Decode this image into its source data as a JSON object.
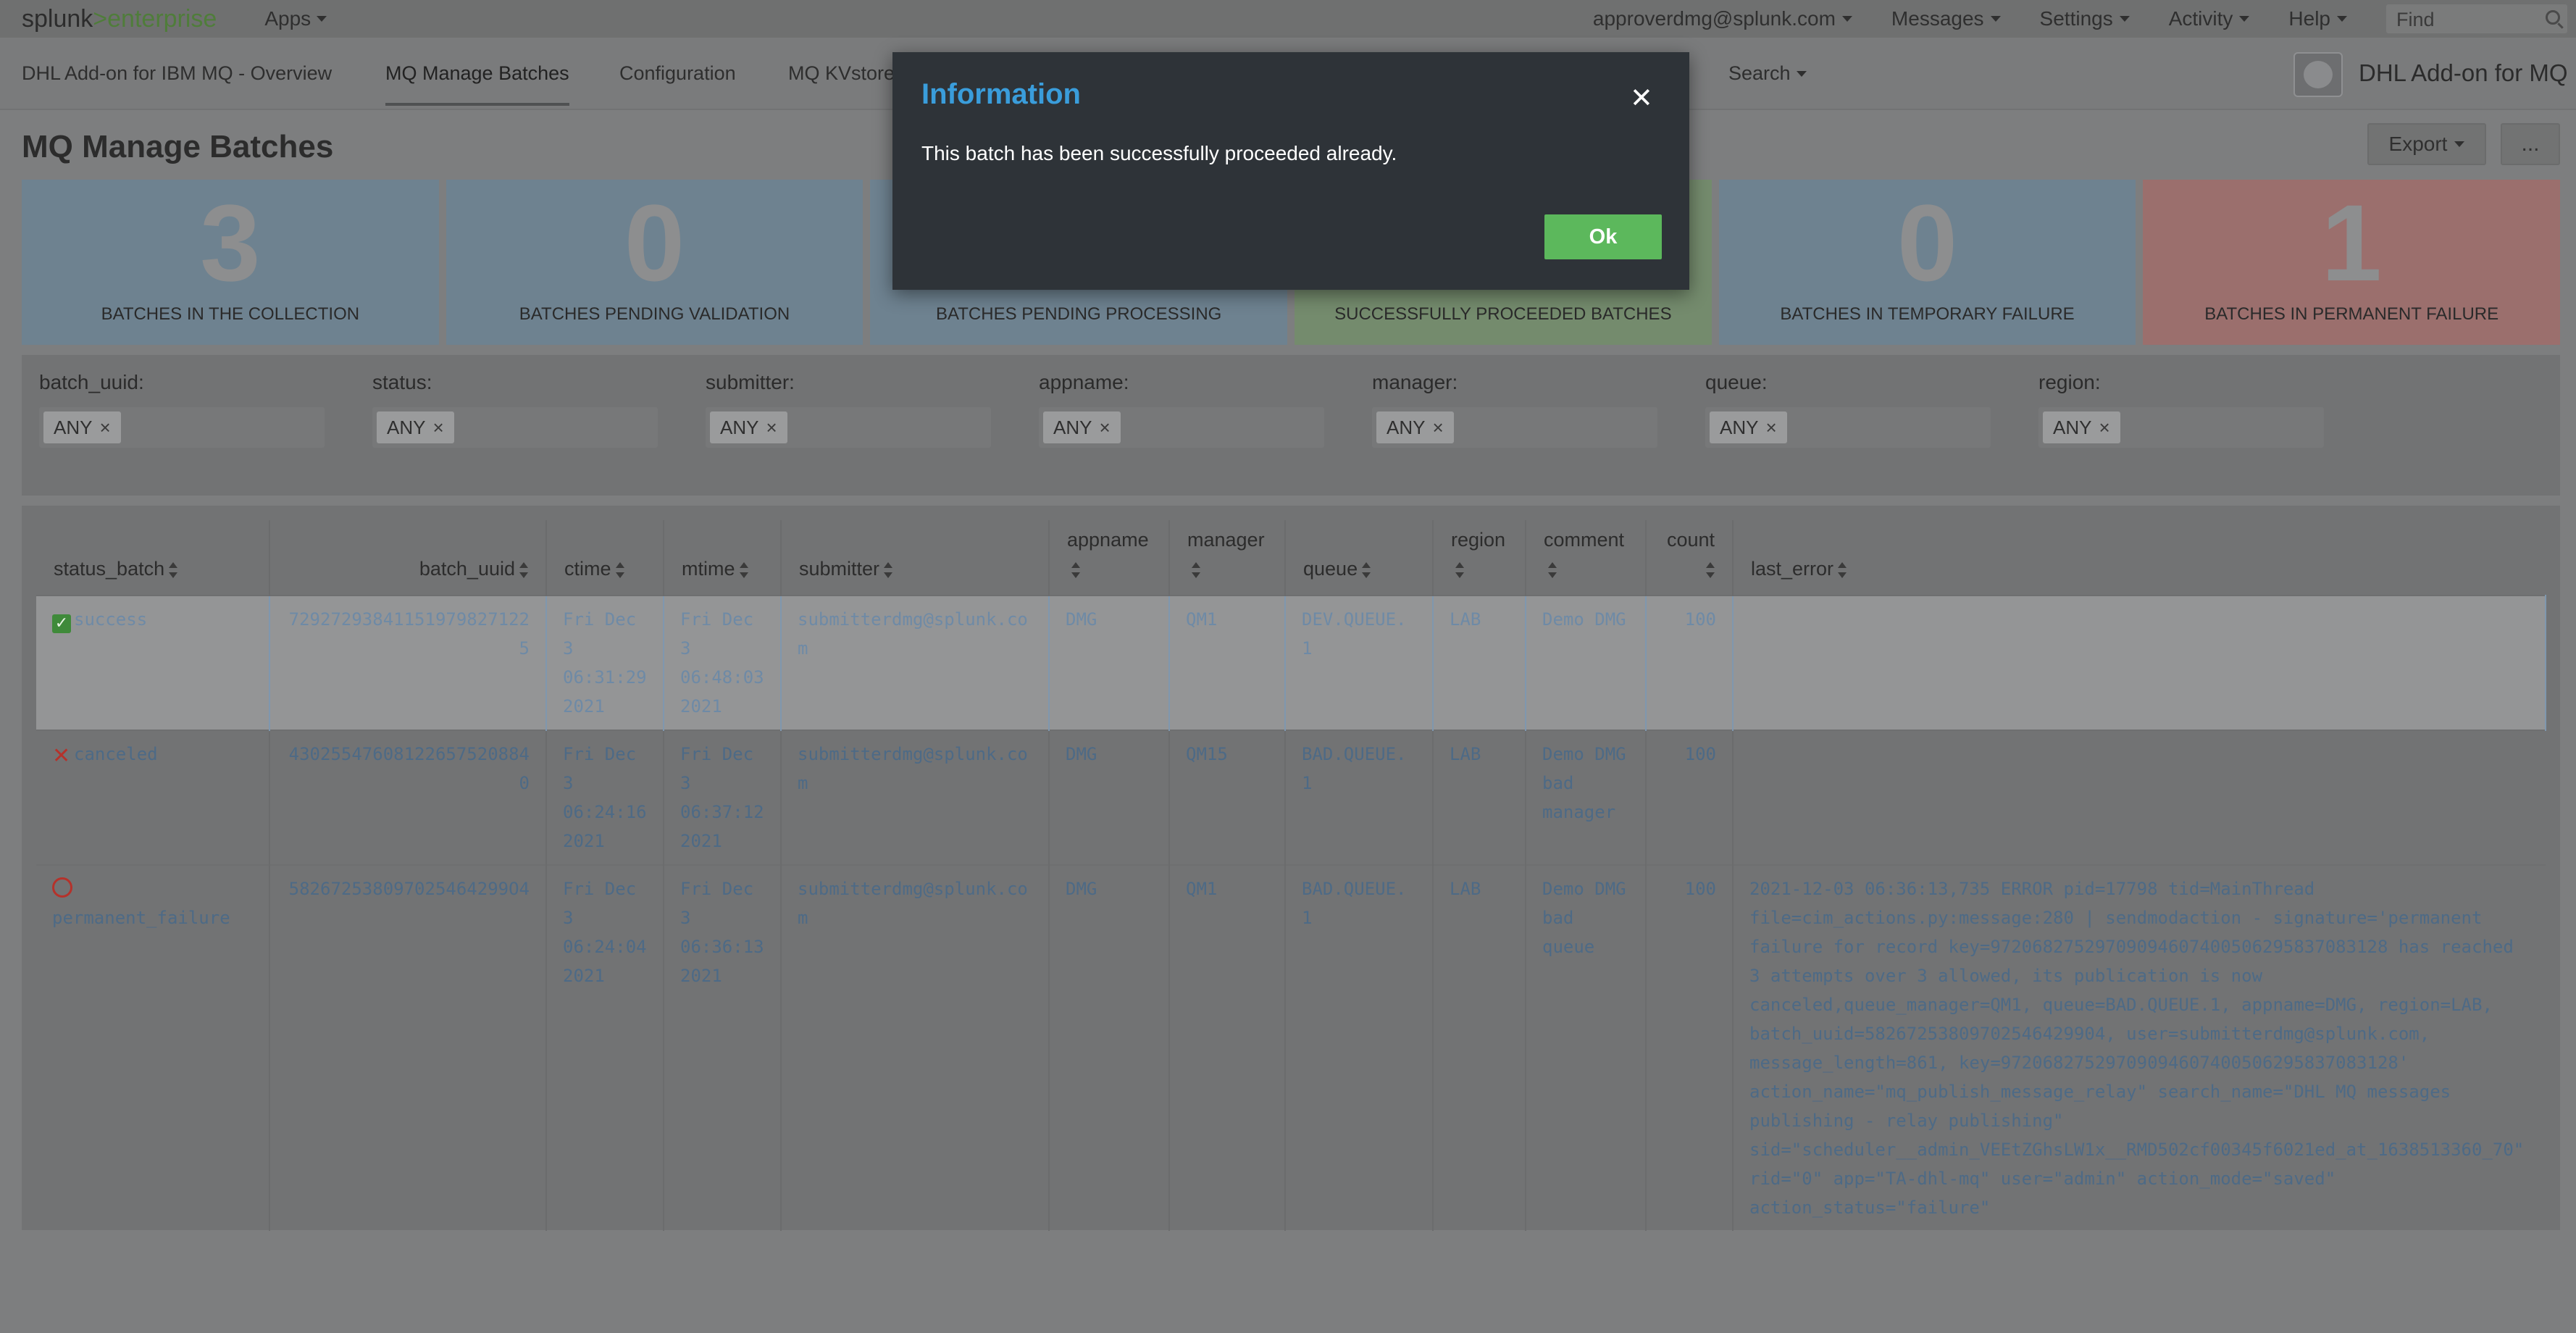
{
  "global_bar": {
    "logo_splunk": "splunk",
    "logo_sep": ">",
    "logo_product": "enterprise",
    "apps": "Apps",
    "user": "approverdmg@splunk.com",
    "messages": "Messages",
    "settings": "Settings",
    "activity": "Activity",
    "help": "Help",
    "find_placeholder": "Find"
  },
  "app_nav": {
    "tabs": [
      {
        "label": "DHL Add-on for IBM MQ - Overview"
      },
      {
        "label": "MQ Manage Batches",
        "active": true
      },
      {
        "label": "Configuration"
      },
      {
        "label": "MQ KVstore"
      }
    ],
    "search": "Search",
    "app_title": "DHL Add-on for MQ"
  },
  "page": {
    "title": "MQ Manage Batches",
    "export_label": "Export",
    "more_label": "..."
  },
  "kpis": [
    {
      "value": "3",
      "label": "BATCHES IN THE COLLECTION",
      "color": "#6e8290"
    },
    {
      "value": "0",
      "label": "BATCHES PENDING VALIDATION",
      "color": "#6e8290"
    },
    {
      "value": "",
      "label": "BATCHES PENDING PROCESSING",
      "color": "#6e8290"
    },
    {
      "value": "",
      "label": "SUCCESSFULLY PROCEEDED BATCHES",
      "color": "#748b6d"
    },
    {
      "value": "0",
      "label": "BATCHES IN TEMPORARY FAILURE",
      "color": "#6e8290"
    },
    {
      "value": "1",
      "label": "BATCHES IN PERMANENT FAILURE",
      "color": "#9b6f6d"
    }
  ],
  "filters": [
    {
      "label": "batch_uuid:",
      "value": "ANY"
    },
    {
      "label": "status:",
      "value": "ANY"
    },
    {
      "label": "submitter:",
      "value": "ANY"
    },
    {
      "label": "appname:",
      "value": "ANY"
    },
    {
      "label": "manager:",
      "value": "ANY"
    },
    {
      "label": "queue:",
      "value": "ANY"
    },
    {
      "label": "region:",
      "value": "ANY"
    }
  ],
  "table": {
    "columns": [
      "status_batch",
      "batch_uuid",
      "ctime",
      "mtime",
      "submitter",
      "appname",
      "manager",
      "queue",
      "region",
      "comment",
      "count",
      "last_error"
    ],
    "rows": [
      {
        "status_icon": "check-icon",
        "status_batch": "success",
        "batch_uuid": "729272938411519798271225",
        "ctime": [
          "Fri Dec",
          "3",
          "06:31:29",
          "2021"
        ],
        "mtime": [
          "Fri Dec",
          "3",
          "06:48:03",
          "2021"
        ],
        "submitter": "submitterdmg@splunk.com",
        "appname": "DMG",
        "manager": "QM1",
        "queue": "DEV.QUEUE.1",
        "region": "LAB",
        "comment": [
          "Demo DMG"
        ],
        "count": "100",
        "last_error": ""
      },
      {
        "status_icon": "cross-icon",
        "status_batch": "canceled",
        "batch_uuid": "430255476081226575208840",
        "ctime": [
          "Fri Dec",
          "3",
          "06:24:16",
          "2021"
        ],
        "mtime": [
          "Fri Dec",
          "3",
          "06:37:12",
          "2021"
        ],
        "submitter": "submitterdmg@splunk.com",
        "appname": "DMG",
        "manager": "QM15",
        "queue": "BAD.QUEUE.1",
        "region": "LAB",
        "comment": [
          "Demo DMG",
          "bad",
          "manager"
        ],
        "count": "100",
        "last_error": ""
      },
      {
        "status_icon": "blocked-icon",
        "status_batch": "permanent_failure",
        "batch_uuid": "582672538097025464299O4",
        "ctime": [
          "Fri Dec",
          "3",
          "06:24:04",
          "2021"
        ],
        "mtime": [
          "Fri Dec",
          "3",
          "06:36:13",
          "2021"
        ],
        "submitter": "submitterdmg@splunk.com",
        "appname": "DMG",
        "manager": "QM1",
        "queue": "BAD.QUEUE.1",
        "region": "LAB",
        "comment": [
          "Demo DMG",
          "bad",
          "queue"
        ],
        "count": "100",
        "last_error": "2021-12-03 06:36:13,735 ERROR pid=17798 tid=MainThread file=cim_actions.py:message:280 | sendmodaction - signature='permanent failure for record key=972068275297090946074005062958370831​28 has reached 3 attempts over 3 allowed, its publication is now canceled,queue_manager=QM1, queue=BAD.QUEUE.1, appname=DMG, region=LAB, batch_uuid=58267253809702546429904, user=submitterdmg@splunk.com, message_length=861, key=97206827529709094607400506295837083128' action_name=\"mq_publish_message_relay\" search_name=\"DHL MQ messages publishing - relay publishing\" sid=\"scheduler__admin_VEEtZGhsLW1x__RMD502cf00345f6021ed_at_1638513360_70\" rid=\"0\" app=\"TA-dhl-mq\" user=\"admin\" action_mode=\"saved\" action_status=\"failure\""
      }
    ]
  },
  "modal": {
    "title": "Information",
    "message": "This batch has been successfully proceeded already.",
    "ok_label": "Ok",
    "close_glyph": "✕"
  }
}
